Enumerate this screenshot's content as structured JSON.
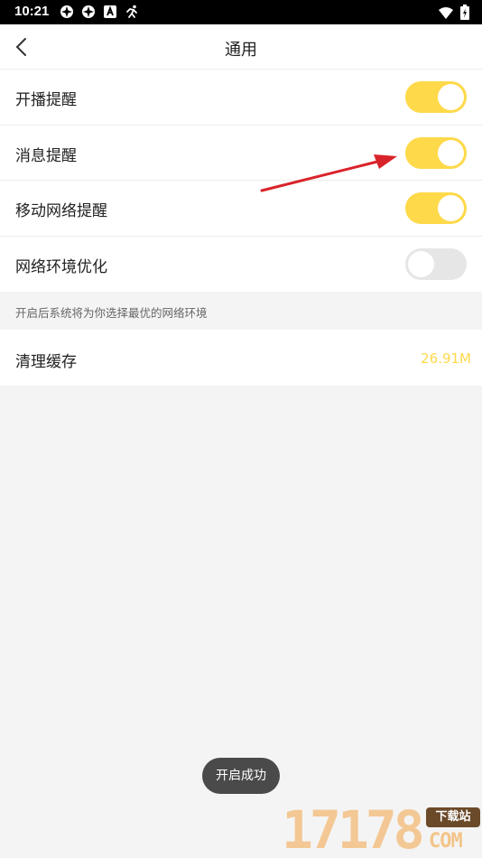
{
  "status_bar": {
    "time": "10:21",
    "left_icons": [
      "notification-app-icon",
      "notification-app-icon",
      "accessibility-a-icon",
      "running-figure-icon"
    ],
    "right_icons": [
      "wifi-icon",
      "battery-charging-icon"
    ]
  },
  "header": {
    "title": "通用",
    "back_icon": "chevron-left-icon"
  },
  "settings": [
    {
      "label": "开播提醒",
      "enabled": true
    },
    {
      "label": "消息提醒",
      "enabled": true
    },
    {
      "label": "移动网络提醒",
      "enabled": true
    },
    {
      "label": "网络环境优化",
      "enabled": false
    }
  ],
  "hint": "开启后系统将为你选择最优的网络环境",
  "cache": {
    "label": "清理缓存",
    "value": "26.91M"
  },
  "toast": "开启成功",
  "watermark": {
    "digits": "17178",
    "tag": "下载站",
    "com": "COM"
  },
  "colors": {
    "accent": "#fed94a",
    "toggle_off": "#e6e6e6",
    "arrow": "#d9232a",
    "toast_bg": "#4a4a4a"
  }
}
